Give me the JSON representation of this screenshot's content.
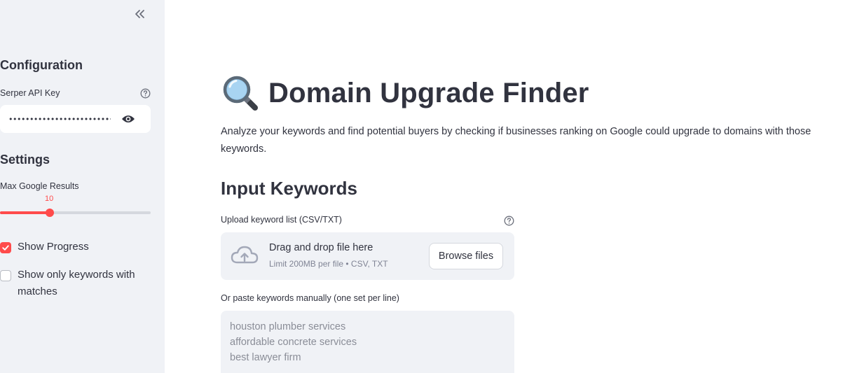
{
  "sidebar": {
    "configuration_heading": "Configuration",
    "api_key_label": "Serper API Key",
    "api_key_masked": "•••••••••••••••••••••••••••••••••",
    "settings_heading": "Settings",
    "max_results_label": "Max Google Results",
    "max_results_value": "10",
    "max_results_fraction": 0.33,
    "show_progress_label": "Show Progress",
    "show_progress_checked": true,
    "only_matches_label": "Show only keywords with matches",
    "only_matches_checked": false
  },
  "main": {
    "title": "Domain Upgrade Finder",
    "title_icon": "magnifying-glass-icon",
    "subtitle": "Analyze your keywords and find potential buyers by checking if businesses ranking on Google could upgrade to domains with those keywords.",
    "input_heading": "Input Keywords",
    "upload_label": "Upload keyword list (CSV/TXT)",
    "drop_title": "Drag and drop file here",
    "drop_limit": "Limit 200MB per file • CSV, TXT",
    "browse_label": "Browse files",
    "paste_label": "Or paste keywords manually (one set per line)",
    "paste_placeholder": "houston plumber services\naffordable concrete services\nbest lawyer firm"
  },
  "colors": {
    "accent": "#ff4b4b",
    "sidebar_bg": "#f0f2f6",
    "text": "#31333f"
  }
}
